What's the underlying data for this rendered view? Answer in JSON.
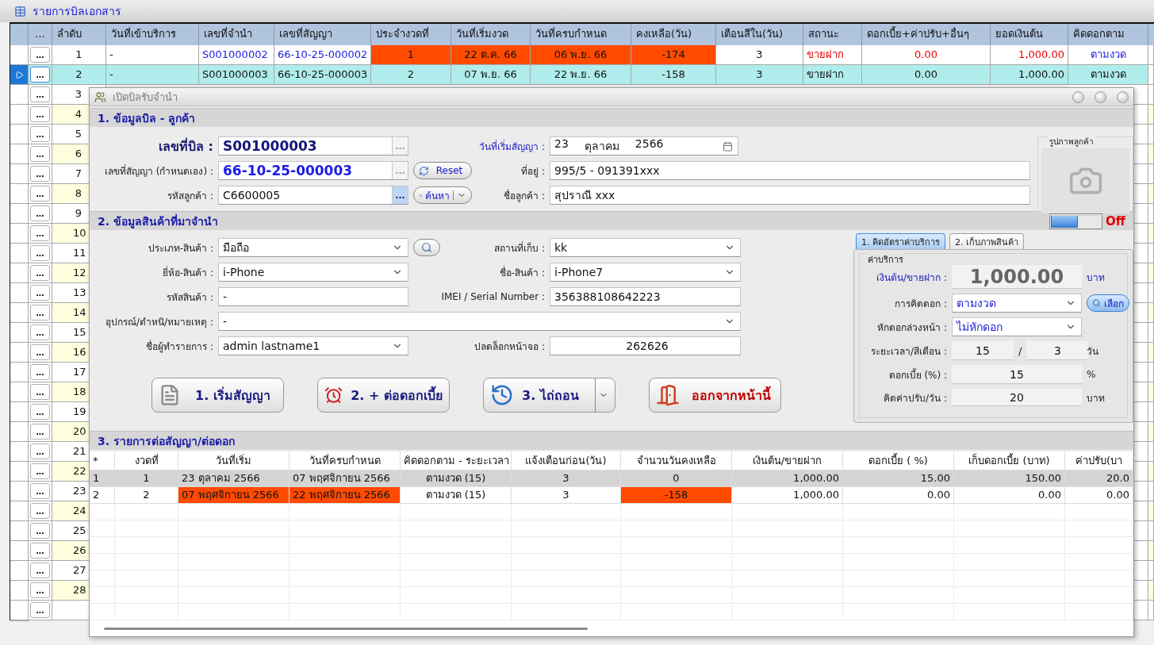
{
  "window": {
    "title": "รายการบิลเอกสาร"
  },
  "grid": {
    "button_header": "...",
    "columns": [
      "ลำดับ",
      "วันที่เข้าบริการ",
      "เลขที่จำนำ",
      "เลขที่สัญญา",
      "ประจำงวดที่",
      "วันที่เริ่มงวด",
      "วันที่ครบกำหนด",
      "คงเหลือ(วัน)",
      "เตือนสีใน(วัน)",
      "สถานะ",
      "ดอกเบี้ย+ค่าปรับ+อื่นๆ",
      "ยอดเงินต้น",
      "คิดดอกตาม"
    ],
    "rows": [
      {
        "button": "...",
        "selected": false,
        "cells": [
          {
            "text": "1",
            "highlight": false
          },
          {
            "text": "-",
            "highlight": false
          },
          {
            "text": "S001000002",
            "highlight": false
          },
          {
            "text": "66-10-25-000002",
            "highlight": false
          },
          {
            "text": "1",
            "highlight": true
          },
          {
            "text": "22 ต.ค. 66",
            "highlight": true
          },
          {
            "text": "06 พ.ย. 66",
            "highlight": true
          },
          {
            "text": "-174",
            "highlight": true
          },
          {
            "text": "3",
            "highlight": false
          },
          {
            "text": "ขายฝาก",
            "highlight": false
          },
          {
            "text": "0.00",
            "highlight": false
          },
          {
            "text": "1,000.00",
            "highlight": false
          },
          {
            "text": "ตามงวด",
            "highlight": false
          }
        ]
      },
      {
        "button": "...",
        "selected": true,
        "cells": [
          {
            "text": "2",
            "highlight": false
          },
          {
            "text": "-",
            "highlight": false
          },
          {
            "text": "S001000003",
            "highlight": false
          },
          {
            "text": "66-10-25-000003",
            "highlight": false
          },
          {
            "text": "2",
            "highlight": false
          },
          {
            "text": "07 พ.ย. 66",
            "highlight": false
          },
          {
            "text": "22 พ.ย. 66",
            "highlight": false
          },
          {
            "text": "-158",
            "highlight": false
          },
          {
            "text": "3",
            "highlight": false
          },
          {
            "text": "ขายฝาก",
            "highlight": false
          },
          {
            "text": "0.00",
            "highlight": false
          },
          {
            "text": "1,000.00",
            "highlight": false
          },
          {
            "text": "ตามงวด",
            "highlight": false
          }
        ]
      }
    ],
    "covered_rows": [
      {
        "button": "...",
        "number": "3"
      },
      {
        "button": "...",
        "number": "4"
      },
      {
        "button": "...",
        "number": "5"
      },
      {
        "button": "...",
        "number": "6"
      },
      {
        "button": "...",
        "number": "7"
      },
      {
        "button": "...",
        "number": "8"
      },
      {
        "button": "...",
        "number": "9"
      },
      {
        "button": "...",
        "number": "10"
      },
      {
        "button": "...",
        "number": "11"
      },
      {
        "button": "...",
        "number": "12"
      },
      {
        "button": "...",
        "number": "13"
      },
      {
        "button": "...",
        "number": "14"
      },
      {
        "button": "...",
        "number": "15"
      },
      {
        "button": "...",
        "number": "16"
      },
      {
        "button": "...",
        "number": "17"
      },
      {
        "button": "...",
        "number": "18"
      },
      {
        "button": "...",
        "number": "19"
      },
      {
        "button": "...",
        "number": "20"
      },
      {
        "button": "...",
        "number": "21"
      },
      {
        "button": "...",
        "number": "22"
      },
      {
        "button": "...",
        "number": "23"
      },
      {
        "button": "...",
        "number": "24"
      },
      {
        "button": "...",
        "number": "25"
      },
      {
        "button": "...",
        "number": "26"
      },
      {
        "button": "...",
        "number": "27"
      },
      {
        "button": "...",
        "number": "28"
      },
      {
        "button": "..."
      }
    ]
  },
  "dialog": {
    "title": "เปิดบิลรับจำนำ",
    "section1": {
      "title": "1. ข้อมูลบิล - ลูกค้า",
      "bill_no": {
        "label": "เลขที่บิล :",
        "value": "S001000003",
        "button": "..."
      },
      "contract_no": {
        "label": "เลขที่สัญญา (กำหนดเอง) :",
        "value": "66-10-25-000003",
        "button": "..."
      },
      "customer_code": {
        "label": "รหัสลูกค้า :",
        "value": "C6600005",
        "button": "..."
      },
      "reset_button": "Reset",
      "search_button": "ค้นหา",
      "start_date": {
        "label": "วันที่เริ่มสัญญา :",
        "day": "23",
        "month": "ตุลาคม",
        "year": "2566"
      },
      "address": {
        "label": "ที่อยู่ :",
        "value": "995/5 - 091391xxx"
      },
      "customer_name": {
        "label": "ชื่อลูกค้า :",
        "value": "สุปราณี xxx"
      },
      "photo": {
        "title": "รูปภาพลูกค้า"
      }
    },
    "section2": {
      "title": "2. ข้อมูลสินค้าที่มาจำนำ",
      "toggle": {
        "on": false,
        "label": "Off"
      },
      "rows": [
        {
          "left": {
            "kind": "select-search",
            "label": "ประเภท-สินค้า :",
            "value": "มือถือ"
          },
          "right": {
            "kind": "select",
            "label": "สถานที่เก็บ   :",
            "value": "kk"
          }
        },
        {
          "left": {
            "kind": "select",
            "label": "ยี่ห้อ-สินค้า :",
            "value": "i-Phone"
          },
          "right": {
            "kind": "select",
            "label": "ชื่อ-สินค้า :",
            "value": "i-Phone7"
          }
        },
        {
          "left": {
            "kind": "text",
            "label": "รหัสสินค้า :",
            "value": "-"
          },
          "right": {
            "kind": "text",
            "label": "IMEI / Serial Number :",
            "value": "356388108642223"
          }
        },
        {
          "left": {
            "kind": "select",
            "label": "อุปกรณ์/ตำหนิ/หมายเหตุ :",
            "value": "-"
          }
        },
        {
          "left": {
            "kind": "select",
            "label": "ชื่อผู้ทำรายการ  :",
            "value": "admin lastname1"
          },
          "right": {
            "kind": "text-center",
            "label": "ปลดล็อกหน้าจอ :",
            "value": "262626"
          }
        }
      ],
      "actions": [
        {
          "kind": "start",
          "label": "1. เริ่มสัญญา"
        },
        {
          "kind": "renew",
          "label": "2. + ต่อดอกเบี้ย"
        },
        {
          "kind": "redeem",
          "label": "3. ไถ่ถอน"
        },
        {
          "kind": "exit",
          "label": "ออกจากหน้านี้"
        }
      ],
      "tabs": [
        {
          "label": "1. คิดอัตราค่าบริการ",
          "selected": true
        },
        {
          "label": "2. เก็บภาพสินค้า",
          "selected": false
        }
      ],
      "service": {
        "title": "ค่าบริการ",
        "principal": {
          "label": "เงินต้น/ขายฝาก :",
          "value": "1,000.00",
          "unit": "บาท"
        },
        "interest_method": {
          "label": "การคิดดอก :",
          "value": "ตามงวด",
          "button": "เลือก"
        },
        "deduct": {
          "label": "หักดอกล่วงหน้า :",
          "value": "ไม่หักดอก"
        },
        "period": {
          "label": "ระยะเวลา/สีเตือน :",
          "value": "15",
          "separator": "/",
          "value2": "3",
          "unit": "วัน"
        },
        "rate": {
          "label": "ดอกเบี้ย (%) :",
          "value": "15",
          "unit": "%"
        },
        "fine": {
          "label": "คิดค่าปรับ/วัน :",
          "value": "20",
          "unit": "บาท"
        }
      }
    },
    "section3": {
      "title": "3. รายการต่อสัญญา/ต่อดอก",
      "columns": [
        "*",
        "งวดที่",
        "วันที่เริ่ม",
        "วันที่ครบกำหนด",
        "คิดดอกตาม - ระยะเวลา",
        "แจ้งเตือนก่อน(วัน)",
        "จำนวนวันคงเหลือ",
        "เงินต้น/ขายฝาก",
        "ดอกเบี้ย ( %)",
        "เก็บดอกเบี้ย (บาท)",
        "ค่าปรับ(บา"
      ],
      "rows": [
        {
          "selected": true,
          "cells": [
            {
              "text": "1",
              "highlight": false
            },
            {
              "text": "1",
              "highlight": false
            },
            {
              "text": "23 ตุลาคม 2566",
              "highlight": false
            },
            {
              "text": "07 พฤศจิกายน 2566",
              "highlight": false
            },
            {
              "text": "ตามงวด  (15)",
              "highlight": false
            },
            {
              "text": "3",
              "highlight": false
            },
            {
              "text": "0",
              "highlight": false
            },
            {
              "text": "1,000.00",
              "highlight": false
            },
            {
              "text": "15.00",
              "highlight": false
            },
            {
              "text": "150.00",
              "highlight": false
            },
            {
              "text": "20.0",
              "highlight": false
            }
          ]
        },
        {
          "selected": false,
          "cells": [
            {
              "text": "2",
              "highlight": false
            },
            {
              "text": "2",
              "highlight": false
            },
            {
              "text": "07 พฤศจิกายน 2566",
              "highlight": true
            },
            {
              "text": "22 พฤศจิกายน 2566",
              "highlight": true
            },
            {
              "text": "ตามงวด  (15)",
              "highlight": false
            },
            {
              "text": "3",
              "highlight": false
            },
            {
              "text": "-158",
              "highlight": true
            },
            {
              "text": "1,000.00",
              "highlight": false
            },
            {
              "text": "0.00",
              "highlight": false
            },
            {
              "text": "0.00",
              "highlight": false
            },
            {
              "text": "0.00",
              "highlight": false
            }
          ]
        }
      ]
    }
  }
}
